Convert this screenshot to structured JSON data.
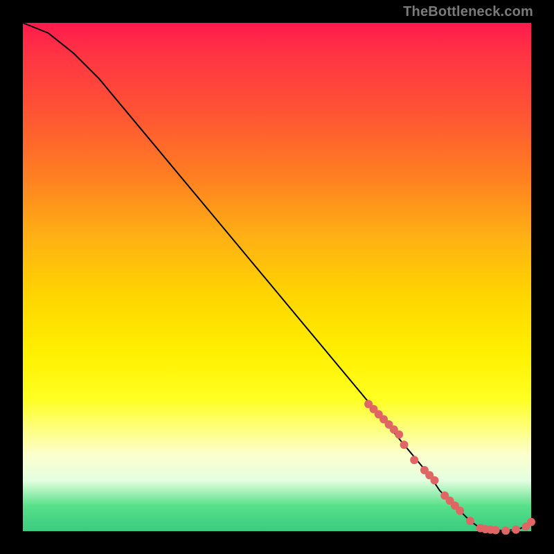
{
  "watermark": "TheBottleneck.com",
  "chart_data": {
    "type": "line",
    "title": "",
    "xlabel": "",
    "ylabel": "",
    "xlim": [
      0,
      100
    ],
    "ylim": [
      0,
      100
    ],
    "grid": false,
    "series": [
      {
        "name": "curve",
        "style": "line",
        "color": "#000000",
        "x": [
          0,
          5,
          10,
          15,
          20,
          25,
          30,
          35,
          40,
          45,
          50,
          55,
          60,
          65,
          70,
          75,
          80,
          82,
          85,
          88,
          90,
          93,
          95,
          97,
          99,
          100
        ],
        "y": [
          100,
          98,
          94,
          89,
          83,
          77,
          71,
          65,
          59,
          53,
          47,
          41,
          35,
          29,
          23,
          17,
          11,
          8,
          5,
          2,
          0.6,
          0.2,
          0.1,
          0.3,
          0.9,
          1.8
        ]
      },
      {
        "name": "dots",
        "style": "scatter",
        "color": "#e06666",
        "x": [
          68,
          69,
          70,
          71,
          72,
          73,
          74,
          75,
          77,
          79,
          80,
          81,
          83,
          84,
          85,
          86,
          88,
          90,
          91,
          92,
          93,
          95,
          97,
          99,
          100
        ],
        "y": [
          25,
          24,
          23,
          22,
          21,
          20,
          19,
          17,
          14,
          12,
          11,
          10,
          7,
          6,
          5,
          4,
          2,
          0.6,
          0.4,
          0.3,
          0.2,
          0.1,
          0.3,
          0.9,
          1.8
        ]
      }
    ]
  }
}
